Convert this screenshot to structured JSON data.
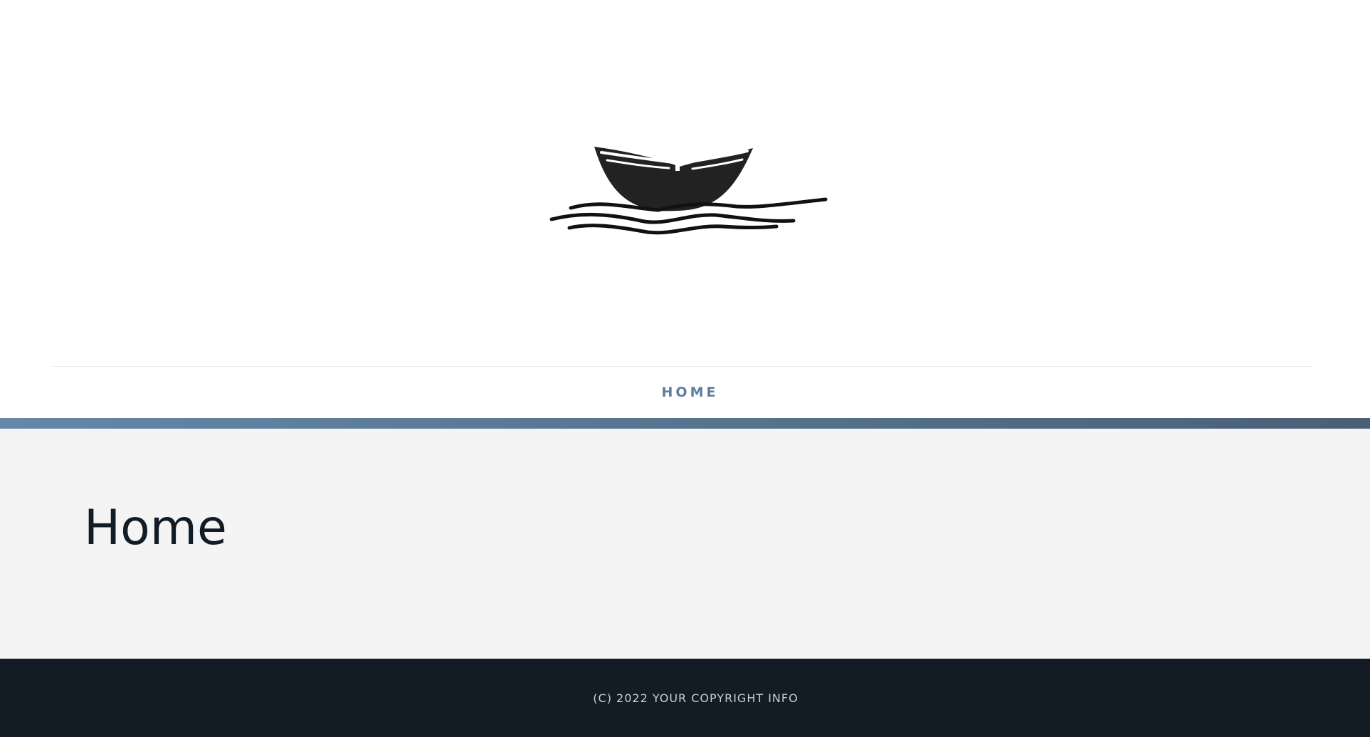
{
  "header": {
    "logo_icon": "rowboat-on-waves-logo"
  },
  "nav": {
    "items": [
      {
        "label": "HOME"
      }
    ]
  },
  "main": {
    "title": "Home"
  },
  "footer": {
    "copyright": "(C) 2022 YOUR COPYRIGHT INFO"
  },
  "colors": {
    "nav_link": "#5d7e9c",
    "accent_start": "#6488a7",
    "accent_end": "#4a6077",
    "content_bg": "#f4f4f4",
    "title": "#121c26",
    "footer_bg": "#131c24",
    "footer_text": "#c9ced3"
  }
}
